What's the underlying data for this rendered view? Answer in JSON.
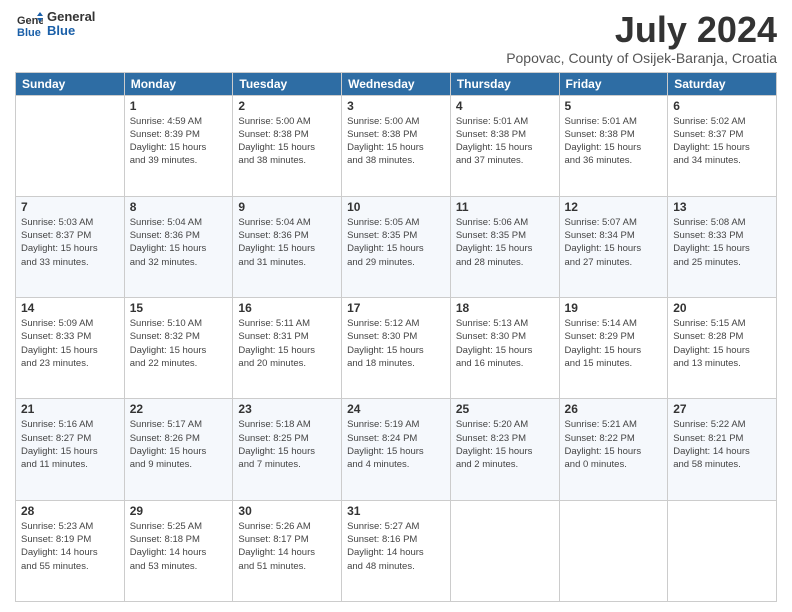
{
  "logo": {
    "line1": "General",
    "line2": "Blue"
  },
  "title": "July 2024",
  "subtitle": "Popovac, County of Osijek-Baranja, Croatia",
  "days_of_week": [
    "Sunday",
    "Monday",
    "Tuesday",
    "Wednesday",
    "Thursday",
    "Friday",
    "Saturday"
  ],
  "weeks": [
    [
      {
        "day": "",
        "info": ""
      },
      {
        "day": "1",
        "info": "Sunrise: 4:59 AM\nSunset: 8:39 PM\nDaylight: 15 hours\nand 39 minutes."
      },
      {
        "day": "2",
        "info": "Sunrise: 5:00 AM\nSunset: 8:38 PM\nDaylight: 15 hours\nand 38 minutes."
      },
      {
        "day": "3",
        "info": "Sunrise: 5:00 AM\nSunset: 8:38 PM\nDaylight: 15 hours\nand 38 minutes."
      },
      {
        "day": "4",
        "info": "Sunrise: 5:01 AM\nSunset: 8:38 PM\nDaylight: 15 hours\nand 37 minutes."
      },
      {
        "day": "5",
        "info": "Sunrise: 5:01 AM\nSunset: 8:38 PM\nDaylight: 15 hours\nand 36 minutes."
      },
      {
        "day": "6",
        "info": "Sunrise: 5:02 AM\nSunset: 8:37 PM\nDaylight: 15 hours\nand 34 minutes."
      }
    ],
    [
      {
        "day": "7",
        "info": "Sunrise: 5:03 AM\nSunset: 8:37 PM\nDaylight: 15 hours\nand 33 minutes."
      },
      {
        "day": "8",
        "info": "Sunrise: 5:04 AM\nSunset: 8:36 PM\nDaylight: 15 hours\nand 32 minutes."
      },
      {
        "day": "9",
        "info": "Sunrise: 5:04 AM\nSunset: 8:36 PM\nDaylight: 15 hours\nand 31 minutes."
      },
      {
        "day": "10",
        "info": "Sunrise: 5:05 AM\nSunset: 8:35 PM\nDaylight: 15 hours\nand 29 minutes."
      },
      {
        "day": "11",
        "info": "Sunrise: 5:06 AM\nSunset: 8:35 PM\nDaylight: 15 hours\nand 28 minutes."
      },
      {
        "day": "12",
        "info": "Sunrise: 5:07 AM\nSunset: 8:34 PM\nDaylight: 15 hours\nand 27 minutes."
      },
      {
        "day": "13",
        "info": "Sunrise: 5:08 AM\nSunset: 8:33 PM\nDaylight: 15 hours\nand 25 minutes."
      }
    ],
    [
      {
        "day": "14",
        "info": "Sunrise: 5:09 AM\nSunset: 8:33 PM\nDaylight: 15 hours\nand 23 minutes."
      },
      {
        "day": "15",
        "info": "Sunrise: 5:10 AM\nSunset: 8:32 PM\nDaylight: 15 hours\nand 22 minutes."
      },
      {
        "day": "16",
        "info": "Sunrise: 5:11 AM\nSunset: 8:31 PM\nDaylight: 15 hours\nand 20 minutes."
      },
      {
        "day": "17",
        "info": "Sunrise: 5:12 AM\nSunset: 8:30 PM\nDaylight: 15 hours\nand 18 minutes."
      },
      {
        "day": "18",
        "info": "Sunrise: 5:13 AM\nSunset: 8:30 PM\nDaylight: 15 hours\nand 16 minutes."
      },
      {
        "day": "19",
        "info": "Sunrise: 5:14 AM\nSunset: 8:29 PM\nDaylight: 15 hours\nand 15 minutes."
      },
      {
        "day": "20",
        "info": "Sunrise: 5:15 AM\nSunset: 8:28 PM\nDaylight: 15 hours\nand 13 minutes."
      }
    ],
    [
      {
        "day": "21",
        "info": "Sunrise: 5:16 AM\nSunset: 8:27 PM\nDaylight: 15 hours\nand 11 minutes."
      },
      {
        "day": "22",
        "info": "Sunrise: 5:17 AM\nSunset: 8:26 PM\nDaylight: 15 hours\nand 9 minutes."
      },
      {
        "day": "23",
        "info": "Sunrise: 5:18 AM\nSunset: 8:25 PM\nDaylight: 15 hours\nand 7 minutes."
      },
      {
        "day": "24",
        "info": "Sunrise: 5:19 AM\nSunset: 8:24 PM\nDaylight: 15 hours\nand 4 minutes."
      },
      {
        "day": "25",
        "info": "Sunrise: 5:20 AM\nSunset: 8:23 PM\nDaylight: 15 hours\nand 2 minutes."
      },
      {
        "day": "26",
        "info": "Sunrise: 5:21 AM\nSunset: 8:22 PM\nDaylight: 15 hours\nand 0 minutes."
      },
      {
        "day": "27",
        "info": "Sunrise: 5:22 AM\nSunset: 8:21 PM\nDaylight: 14 hours\nand 58 minutes."
      }
    ],
    [
      {
        "day": "28",
        "info": "Sunrise: 5:23 AM\nSunset: 8:19 PM\nDaylight: 14 hours\nand 55 minutes."
      },
      {
        "day": "29",
        "info": "Sunrise: 5:25 AM\nSunset: 8:18 PM\nDaylight: 14 hours\nand 53 minutes."
      },
      {
        "day": "30",
        "info": "Sunrise: 5:26 AM\nSunset: 8:17 PM\nDaylight: 14 hours\nand 51 minutes."
      },
      {
        "day": "31",
        "info": "Sunrise: 5:27 AM\nSunset: 8:16 PM\nDaylight: 14 hours\nand 48 minutes."
      },
      {
        "day": "",
        "info": ""
      },
      {
        "day": "",
        "info": ""
      },
      {
        "day": "",
        "info": ""
      }
    ]
  ]
}
